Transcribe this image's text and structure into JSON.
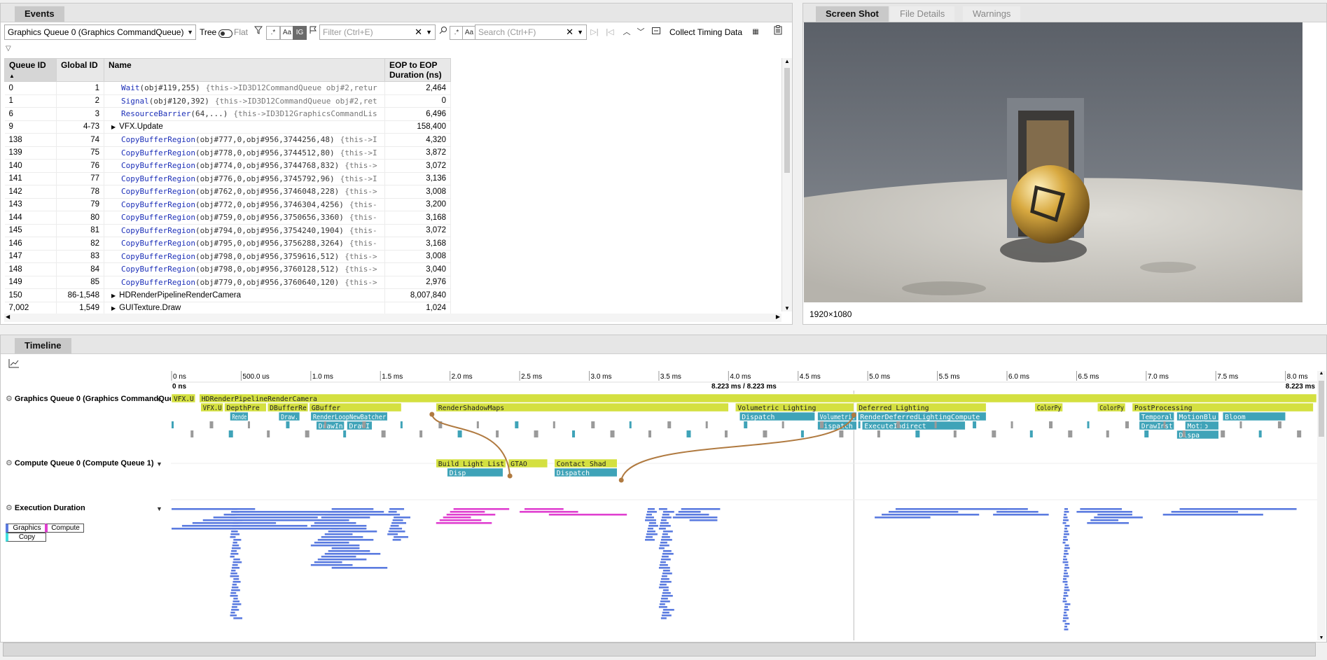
{
  "events_panel": {
    "tab": "Events",
    "queue_select": "Graphics Queue 0 (Graphics CommandQueue)",
    "view_tree": "Tree",
    "view_flat": "Flat",
    "regex_btn": ".*",
    "case_btn": "Aa",
    "ig_btn": "IG",
    "filter_placeholder": "Filter (Ctrl+E)",
    "search_placeholder": "Search (Ctrl+F)",
    "collect_timing": "Collect Timing Data",
    "columns": [
      "Queue ID",
      "Global ID",
      "Name",
      "EOP to EOP Duration (ns)"
    ],
    "rows": [
      {
        "qid": "0",
        "gid": "1",
        "name": "Wait",
        "args": "(obj#119,255)",
        "meta": "{this->ID3D12CommandQueue obj#2,retur",
        "dur": "2,464",
        "expand": false
      },
      {
        "qid": "1",
        "gid": "2",
        "name": "Signal",
        "args": "(obj#120,392)",
        "meta": "{this->ID3D12CommandQueue obj#2,ret",
        "dur": "0",
        "expand": false
      },
      {
        "qid": "6",
        "gid": "3",
        "name": "ResourceBarrier",
        "args": "(64,...)",
        "meta": "{this->ID3D12GraphicsCommandLis",
        "dur": "6,496",
        "expand": false
      },
      {
        "qid": "9",
        "gid": "4-73",
        "name": "VFX.Update",
        "args": "",
        "meta": "",
        "dur": "158,400",
        "expand": true
      },
      {
        "qid": "138",
        "gid": "74",
        "name": "CopyBufferRegion",
        "args": "(obj#777,0,obj#956,3744256,48)",
        "meta": "{this->I",
        "dur": "4,320",
        "expand": false
      },
      {
        "qid": "139",
        "gid": "75",
        "name": "CopyBufferRegion",
        "args": "(obj#778,0,obj#956,3744512,80)",
        "meta": "{this->I",
        "dur": "3,872",
        "expand": false
      },
      {
        "qid": "140",
        "gid": "76",
        "name": "CopyBufferRegion",
        "args": "(obj#774,0,obj#956,3744768,832)",
        "meta": "{this->",
        "dur": "3,072",
        "expand": false
      },
      {
        "qid": "141",
        "gid": "77",
        "name": "CopyBufferRegion",
        "args": "(obj#776,0,obj#956,3745792,96)",
        "meta": "{this->I",
        "dur": "3,136",
        "expand": false
      },
      {
        "qid": "142",
        "gid": "78",
        "name": "CopyBufferRegion",
        "args": "(obj#762,0,obj#956,3746048,228)",
        "meta": "{this->",
        "dur": "3,008",
        "expand": false
      },
      {
        "qid": "143",
        "gid": "79",
        "name": "CopyBufferRegion",
        "args": "(obj#772,0,obj#956,3746304,4256)",
        "meta": "{this-",
        "dur": "3,200",
        "expand": false
      },
      {
        "qid": "144",
        "gid": "80",
        "name": "CopyBufferRegion",
        "args": "(obj#759,0,obj#956,3750656,3360)",
        "meta": "{this-",
        "dur": "3,168",
        "expand": false
      },
      {
        "qid": "145",
        "gid": "81",
        "name": "CopyBufferRegion",
        "args": "(obj#794,0,obj#956,3754240,1904)",
        "meta": "{this-",
        "dur": "3,072",
        "expand": false
      },
      {
        "qid": "146",
        "gid": "82",
        "name": "CopyBufferRegion",
        "args": "(obj#795,0,obj#956,3756288,3264)",
        "meta": "{this-",
        "dur": "3,168",
        "expand": false
      },
      {
        "qid": "147",
        "gid": "83",
        "name": "CopyBufferRegion",
        "args": "(obj#798,0,obj#956,3759616,512)",
        "meta": "{this->",
        "dur": "3,008",
        "expand": false
      },
      {
        "qid": "148",
        "gid": "84",
        "name": "CopyBufferRegion",
        "args": "(obj#798,0,obj#956,3760128,512)",
        "meta": "{this->",
        "dur": "3,040",
        "expand": false
      },
      {
        "qid": "149",
        "gid": "85",
        "name": "CopyBufferRegion",
        "args": "(obj#779,0,obj#956,3760640,120)",
        "meta": "{this->",
        "dur": "2,976",
        "expand": false
      },
      {
        "qid": "150",
        "gid": "86-1,548",
        "name": "HDRenderPipelineRenderCamera",
        "args": "",
        "meta": "",
        "dur": "8,007,840",
        "expand": true
      },
      {
        "qid": "7,002",
        "gid": "1,549",
        "name": "GUITexture.Draw",
        "args": "",
        "meta": "",
        "dur": "1,024",
        "expand": true
      }
    ]
  },
  "screenshot_panel": {
    "tabs": [
      "Screen Shot",
      "File Details",
      "Warnings"
    ],
    "resolution": "1920×1080"
  },
  "timeline": {
    "tab": "Timeline",
    "ticks": [
      "0 ns",
      "500.0 us",
      "1.0 ms",
      "1.5 ms",
      "2.0 ms",
      "2.5 ms",
      "3.0 ms",
      "3.5 ms",
      "4.0 ms",
      "4.5 ms",
      "5.0 ms",
      "5.5 ms",
      "6.0 ms",
      "6.5 ms",
      "7.0 ms",
      "7.5 ms",
      "8.0 ms"
    ],
    "start_label": "0 ns",
    "range_label": "8.223 ms / 8.223 ms",
    "end_label": "8.223 ms",
    "row_graphics": "Graphics Queue 0 (Graphics CommandQueue)",
    "row_compute": "Compute Queue 0 (Compute Queue 1)",
    "row_exec": "Execution Duration",
    "legend": [
      "Graphics",
      "Compute",
      "Copy"
    ],
    "colors": {
      "marker": "#d4e040",
      "dispatch": "#3fa3b8",
      "gray": "#9a9a9a",
      "graphics_bar": "#5b7be0",
      "compute_bar": "#e040d0",
      "copy_bar": "#40e0e0",
      "arrow": "#b07a40"
    },
    "graphics_bars": [
      {
        "label": "VFX.U",
        "row": 0,
        "t0": 0.0,
        "t1": 0.17
      },
      {
        "label": "HDRenderPipelineRenderCamera",
        "row": 0,
        "t0": 0.2,
        "t1": 8.223
      },
      {
        "label": "VFX.U",
        "row": 1,
        "t0": 0.21,
        "t1": 0.37
      },
      {
        "label": "DepthPre",
        "row": 1,
        "t0": 0.38,
        "t1": 0.68
      },
      {
        "label": "DBufferRe",
        "row": 1,
        "t0": 0.69,
        "t1": 0.98
      },
      {
        "label": "GBuffer",
        "row": 1,
        "t0": 0.99,
        "t1": 1.65
      },
      {
        "label": "RenderShadowMaps",
        "row": 1,
        "t0": 1.9,
        "t1": 4.0
      },
      {
        "label": "Volumetric Lighting",
        "row": 1,
        "t0": 4.05,
        "t1": 4.9
      },
      {
        "label": "Deferred Lighting",
        "row": 1,
        "t0": 4.92,
        "t1": 5.85
      },
      {
        "label": "ColorPy",
        "row": 1,
        "t0": 6.2,
        "t1": 6.4
      },
      {
        "label": "ColorPy",
        "row": 1,
        "t0": 6.65,
        "t1": 6.85
      },
      {
        "label": "PostProcessing",
        "row": 1,
        "t0": 6.9,
        "t1": 8.2
      },
      {
        "label": "Rende",
        "row": 2,
        "t0": 0.42,
        "t1": 0.55
      },
      {
        "label": "Draw.",
        "row": 2,
        "t0": 0.77,
        "t1": 0.92
      },
      {
        "label": "RenderLoopNewBatcher",
        "row": 2,
        "t0": 1.0,
        "t1": 1.55
      },
      {
        "label": "Dispatch",
        "row": 2,
        "t0": 4.08,
        "t1": 4.62
      },
      {
        "label": "Volumetric",
        "row": 2,
        "t0": 4.64,
        "t1": 4.92
      },
      {
        "label": "RenderDeferredLightingCompute",
        "row": 2,
        "t0": 4.93,
        "t1": 5.85
      },
      {
        "label": "Temporal",
        "row": 2,
        "t0": 6.95,
        "t1": 7.2
      },
      {
        "label": "MotionBlu",
        "row": 2,
        "t0": 7.22,
        "t1": 7.52
      },
      {
        "label": "Bloom",
        "row": 2,
        "t0": 7.55,
        "t1": 8.0
      },
      {
        "label": "DrawIn",
        "row": 3,
        "t0": 1.04,
        "t1": 1.24
      },
      {
        "label": "DrawI",
        "row": 3,
        "t0": 1.26,
        "t1": 1.44
      },
      {
        "label": "Dispatch",
        "row": 3,
        "t0": 4.64,
        "t1": 4.92
      },
      {
        "label": "ExecuteIndirect",
        "row": 3,
        "t0": 4.96,
        "t1": 5.7
      },
      {
        "label": "DrawInst",
        "row": 3,
        "t0": 6.95,
        "t1": 7.2
      },
      {
        "label": "Motio",
        "row": 3,
        "t0": 7.28,
        "t1": 7.52
      },
      {
        "label": "Dispa",
        "row": 4,
        "t0": 7.22,
        "t1": 7.52
      }
    ],
    "compute_bars": [
      {
        "label": "Build Light List",
        "row": 0,
        "t0": 1.9,
        "t1": 2.4
      },
      {
        "label": "GTAO",
        "row": 0,
        "t0": 2.42,
        "t1": 2.7
      },
      {
        "label": "Contact Shad",
        "row": 0,
        "t0": 2.75,
        "t1": 3.2
      },
      {
        "label": "Disp",
        "row": 1,
        "t0": 1.98,
        "t1": 2.38
      },
      {
        "label": "Dispatch",
        "row": 1,
        "t0": 2.75,
        "t1": 3.2
      }
    ]
  }
}
